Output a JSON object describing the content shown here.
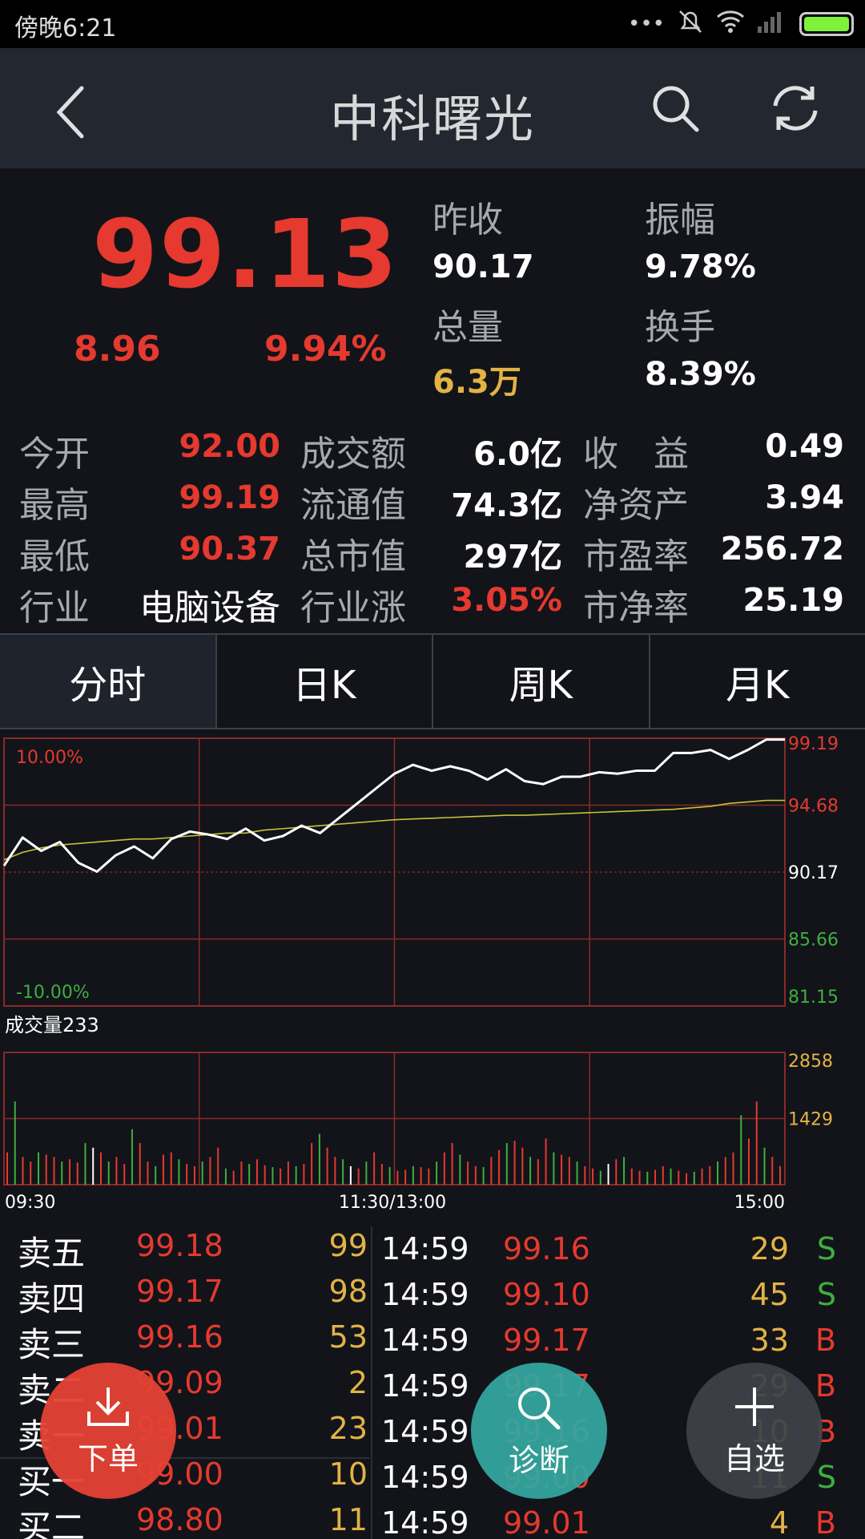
{
  "status_bar": {
    "time": "傍晚6:21",
    "dots": "•••"
  },
  "header": {
    "title": "中科曙光"
  },
  "quote": {
    "price": "99.13",
    "change": "8.96",
    "change_pct": "9.94%",
    "prev_close_label": "昨收",
    "prev_close": "90.17",
    "amplitude_label": "振幅",
    "amplitude": "9.78%",
    "volume_label": "总量",
    "volume": "6.3万",
    "turnover_label": "换手",
    "turnover": "8.39%"
  },
  "stats": {
    "open_label": "今开",
    "open": "92.00",
    "high_label": "最高",
    "high": "99.19",
    "low_label": "最低",
    "low": "90.37",
    "industry_label": "行业",
    "industry": "电脑设备",
    "amount_label": "成交额",
    "amount": "6.0亿",
    "float_label": "流通值",
    "float_cap": "74.3亿",
    "mcap_label": "总市值",
    "mcap": "297亿",
    "ind_up_label": "行业涨",
    "ind_up": "3.05%",
    "eps_label": "收　益",
    "eps": "0.49",
    "bvps_label": "净资产",
    "bvps": "3.94",
    "pe_label": "市盈率",
    "pe": "256.72",
    "pb_label": "市净率",
    "pb": "25.19"
  },
  "tabs": [
    {
      "label": "分时"
    },
    {
      "label": "日K"
    },
    {
      "label": "周K"
    },
    {
      "label": "月K"
    }
  ],
  "chart_data": {
    "type": "line",
    "price_axis_ticks": [
      "99.19",
      "94.68",
      "90.17",
      "85.66",
      "81.15"
    ],
    "pct_top_label": "10.00%",
    "pct_bottom_label": "-10.00%",
    "volume_title": "成交量233",
    "volume_axis_ticks": [
      "2858",
      "1429"
    ],
    "time_labels": [
      "09:30",
      "11:30/13:00",
      "15:00"
    ],
    "ylim": [
      81.15,
      99.19
    ],
    "volume_ylim": [
      0,
      2858
    ],
    "series": [
      {
        "values": [
          90.6,
          92.5,
          91.6,
          92.2,
          90.8,
          90.2,
          91.3,
          91.9,
          91.1,
          92.4,
          92.9,
          92.7,
          92.4,
          93.1,
          92.3,
          92.6,
          93.3,
          92.8,
          93.8,
          94.8,
          95.8,
          96.8,
          97.4,
          97.0,
          97.3,
          97.0,
          96.4,
          97.1,
          96.3,
          96.1,
          96.6,
          96.6,
          96.9,
          96.8,
          97.0,
          97.0,
          98.2,
          98.2,
          98.4,
          97.8,
          98.4,
          99.1,
          99.1
        ]
      },
      {
        "values": [
          91.0,
          91.5,
          91.8,
          92.0,
          92.1,
          92.2,
          92.3,
          92.4,
          92.4,
          92.5,
          92.6,
          92.7,
          92.8,
          92.8,
          93.0,
          93.1,
          93.2,
          93.3,
          93.4,
          93.5,
          93.6,
          93.7,
          93.75,
          93.8,
          93.85,
          93.9,
          93.95,
          94.0,
          94.0,
          94.05,
          94.1,
          94.15,
          94.2,
          94.25,
          94.3,
          94.35,
          94.4,
          94.5,
          94.6,
          94.8,
          94.9,
          95.0,
          95.0
        ]
      }
    ],
    "volume_values": [
      700,
      1800,
      600,
      500,
      700,
      650,
      600,
      500,
      550,
      480,
      900,
      800,
      700,
      500,
      600,
      450,
      1200,
      900,
      500,
      400,
      650,
      700,
      550,
      450,
      400,
      500,
      600,
      800,
      350,
      300,
      500,
      450,
      550,
      420,
      380,
      350,
      500,
      400,
      450,
      900,
      1100,
      800,
      600,
      550,
      400,
      350,
      500,
      700,
      450,
      380,
      300,
      320,
      400,
      380,
      350,
      500,
      700,
      900,
      650,
      500,
      400,
      380,
      600,
      750,
      900,
      950,
      800,
      600,
      550,
      1000,
      700,
      650,
      600,
      500,
      400,
      350,
      300,
      450,
      550,
      600,
      350,
      300,
      280,
      320,
      400,
      350,
      300,
      250,
      280,
      350,
      400,
      500,
      600,
      700,
      1500,
      1000,
      1800,
      800,
      600,
      400
    ]
  },
  "order_book": [
    {
      "label": "卖五",
      "price": "99.18",
      "vol": "99"
    },
    {
      "label": "卖四",
      "price": "99.17",
      "vol": "98"
    },
    {
      "label": "卖三",
      "price": "99.16",
      "vol": "53"
    },
    {
      "label": "卖二",
      "price": "99.09",
      "vol": "2"
    },
    {
      "label": "卖一",
      "price": "99.01",
      "vol": "23"
    },
    {
      "label": "买一",
      "price": "99.00",
      "vol": "10"
    },
    {
      "label": "买二",
      "price": "98.80",
      "vol": "11"
    }
  ],
  "trades": [
    {
      "time": "14:59",
      "price": "99.16",
      "vol": "29",
      "side": "S"
    },
    {
      "time": "14:59",
      "price": "99.10",
      "vol": "45",
      "side": "S"
    },
    {
      "time": "14:59",
      "price": "99.17",
      "vol": "33",
      "side": "B"
    },
    {
      "time": "14:59",
      "price": "99.17",
      "vol": "29",
      "side": "B"
    },
    {
      "time": "14:59",
      "price": "99.16",
      "vol": "10",
      "side": "B"
    },
    {
      "time": "14:59",
      "price": "99.00",
      "vol": "11",
      "side": "S"
    },
    {
      "time": "14:59",
      "price": "99.01",
      "vol": "4",
      "side": "B"
    }
  ],
  "actions": {
    "order": "下单",
    "diagnose": "诊断",
    "watchlist": "自选"
  },
  "colors": {
    "up": "#e6392f",
    "down": "#3fae3f",
    "volume_text": "#e2b345"
  }
}
